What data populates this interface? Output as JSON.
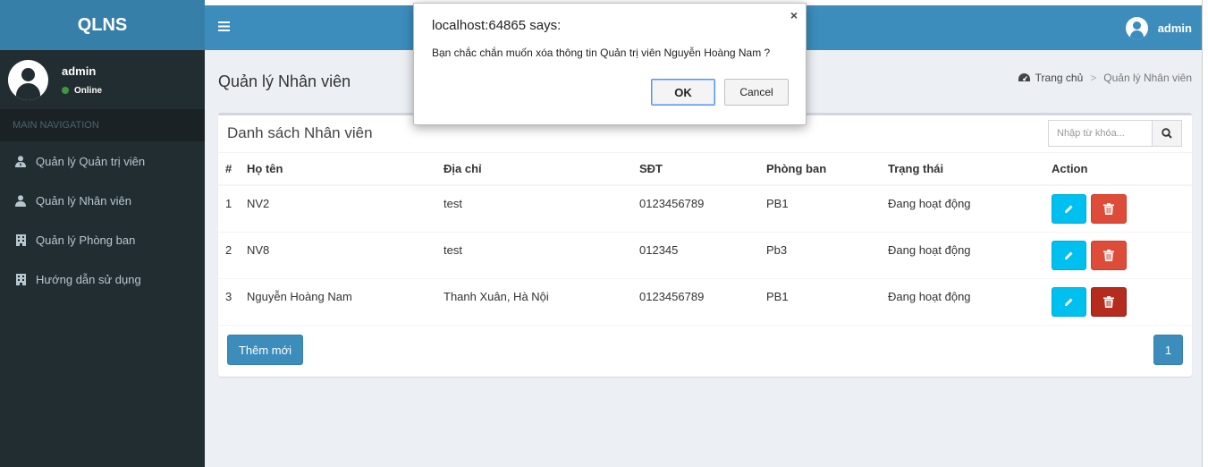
{
  "app": {
    "logo": "QLNS"
  },
  "sidebar": {
    "user_name": "admin",
    "user_status": "Online",
    "nav_header": "MAIN NAVIGATION",
    "items": [
      {
        "label": "Quản lý Quản trị viên",
        "icon": "user-tie-icon"
      },
      {
        "label": "Quản lý Nhân viên",
        "icon": "user-icon"
      },
      {
        "label": "Quản lý Phòng ban",
        "icon": "building-icon"
      },
      {
        "label": "Hướng dẫn sử dụng",
        "icon": "building-icon"
      }
    ]
  },
  "topbar": {
    "user_name": "admin"
  },
  "content": {
    "title": "Quản lý Nhân viên",
    "breadcrumb": {
      "home": "Trang chủ",
      "current": "Quản lý Nhân viên"
    }
  },
  "box": {
    "title": "Danh sách Nhân viên",
    "search_placeholder": "Nhập từ khóa...",
    "add_label": "Thêm mới",
    "page": "1"
  },
  "table": {
    "headers": [
      "#",
      "Họ tên",
      "Địa chỉ",
      "SĐT",
      "Phòng ban",
      "Trạng thái",
      "Action"
    ],
    "rows": [
      {
        "no": "1",
        "name": "NV2",
        "address": "test",
        "phone": "0123456789",
        "dept": "PB1",
        "status": "Đang hoạt động"
      },
      {
        "no": "2",
        "name": "NV8",
        "address": "test",
        "phone": "012345",
        "dept": "Pb3",
        "status": "Đang hoạt động"
      },
      {
        "no": "3",
        "name": "Nguyễn Hoàng Nam",
        "address": "Thanh Xuân, Hà Nội",
        "phone": "0123456789",
        "dept": "PB1",
        "status": "Đang hoạt động"
      }
    ]
  },
  "dialog": {
    "title": "localhost:64865 says:",
    "message": "Bạn chắc chắn muốn xóa thông tin Quản trị viên Nguyễn Hoàng Nam ?",
    "ok_label": "OK",
    "cancel_label": "Cancel",
    "close_glyph": "×"
  },
  "colors": {
    "primary": "#3c8dbc",
    "sidebar": "#222d32",
    "info": "#00c0ef",
    "danger": "#dd4b39"
  }
}
